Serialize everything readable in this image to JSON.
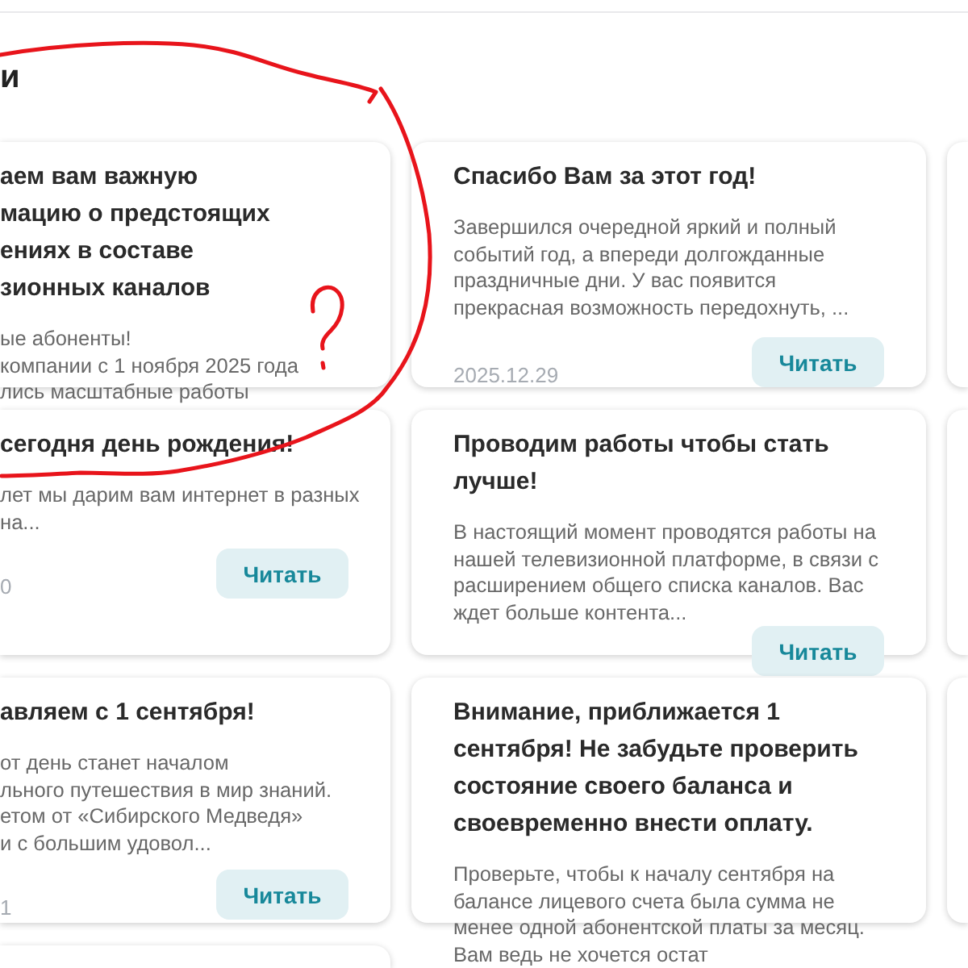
{
  "section": {
    "title": "и"
  },
  "cards": [
    {
      "kind": "clipped",
      "title": "аем вам важную\nмацию о предстоящих\nениях в составе\nзионных каналов",
      "excerpt": "ые абоненты!\nкомпании с 1 ноября 2025 года\nлись масштабные работы"
    },
    {
      "kind": "full",
      "title": "Спасибо Вам за этот год!",
      "excerpt": "Завершился очередной яркий и полный событий год, а впереди долгожданные праздничные дни. У вас появится прекрасная возможность передохнуть, ...",
      "date": "2025.12.29",
      "button": "Читать"
    },
    {
      "kind": "edge"
    },
    {
      "kind": "clipped",
      "title": "сегодня день рождения!",
      "excerpt": "лет мы дарим вам интернет в разных\nна...",
      "date": "0",
      "button": "Читать"
    },
    {
      "kind": "full",
      "title": "Проводим работы чтобы стать лучше!",
      "excerpt": "В настоящий момент проводятся работы на нашей телевизионной платформе, в связи с расширением общего списка каналов. Вас ждет больше контента...",
      "button": "Читать"
    },
    {
      "kind": "edge"
    },
    {
      "kind": "clipped",
      "title": "авляем с 1 сентября!",
      "excerpt": "от день станет началом\nльного путешествия в мир знаний.\nетом от «Сибирского Медведя»\nи с большим удовол...",
      "date": "1",
      "button": "Читать"
    },
    {
      "kind": "full",
      "title": "Внимание, приближается 1 сентября! Не забудьте проверить состояние своего баланса и своевременно внести оплату.",
      "excerpt": "Проверьте, чтобы к началу сентября на балансе лицевого счета была сумма не менее одной абонентской платы за месяц. Вам ведь не хочется остат"
    },
    {
      "kind": "edge"
    },
    {
      "kind": "stub"
    }
  ]
}
